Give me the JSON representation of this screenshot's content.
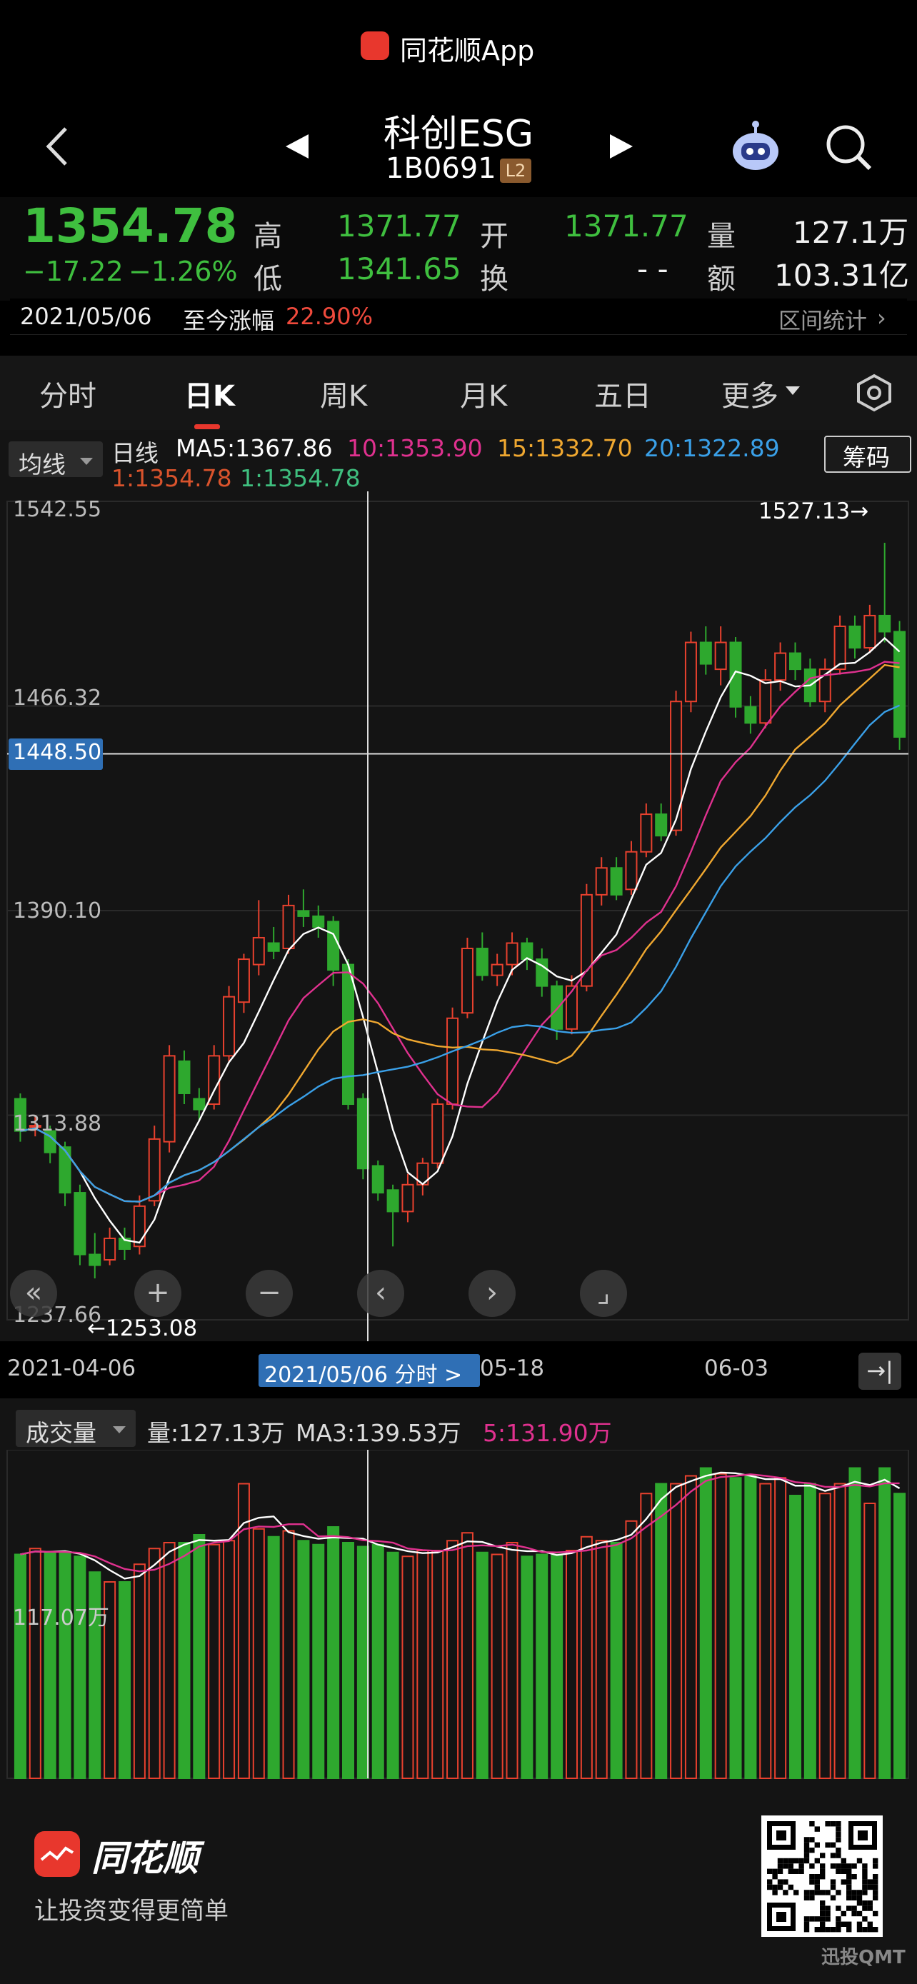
{
  "app": {
    "name": "同花顺App"
  },
  "header": {
    "title": "科创ESG",
    "code": "1B0691",
    "level_badge": "L2"
  },
  "quote": {
    "price": "1354.78",
    "change": "−17.22",
    "change_pct": "−1.26%",
    "high_label": "高",
    "high": "1371.77",
    "low_label": "低",
    "low": "1341.65",
    "open_label": "开",
    "open": "1371.77",
    "turnover_label": "换",
    "turnover": "- -",
    "volume_label": "量",
    "volume": "127.1万",
    "amount_label": "额",
    "amount": "103.31亿"
  },
  "period": {
    "date": "2021/05/06",
    "gain_label": "至今涨幅",
    "gain": "22.90%",
    "stats_label": "区间统计"
  },
  "tabs": [
    "分时",
    "日K",
    "周K",
    "月K",
    "五日",
    "更多"
  ],
  "active_tab": "日K",
  "legend": {
    "dropdown": "均线",
    "period": "日线",
    "ma5": "MA5:1367.86",
    "ma10": "10:1353.90",
    "ma15": "15:1332.70",
    "ma20": "20:1322.89",
    "ma1a": "1:1354.78",
    "ma1b": "1:1354.78",
    "chip_button": "筹码"
  },
  "price_axis": {
    "labels": [
      "1542.55",
      "1466.32",
      "1390.10",
      "1313.88",
      "1237.66"
    ],
    "crosshair_value": "1448.50"
  },
  "annotations": {
    "high_marker": "1527.13→",
    "low_marker": "←1253.08"
  },
  "date_axis": {
    "labels": [
      "2021-04-06",
      "05-18",
      "06-03"
    ],
    "crosshair_date": "2021/05/06 分时 >"
  },
  "volume": {
    "dropdown": "成交量",
    "vol": "量:127.13万",
    "ma3": "MA3:139.53万",
    "ma5": "5:131.90万",
    "axis_label": "117.07万"
  },
  "colors": {
    "up": "#e8412e",
    "down": "#2ea82e",
    "ma5": "#ffffff",
    "ma10": "#e0318f",
    "ma15": "#f0a830",
    "ma20": "#3aa0e8",
    "crosshair_box": "#2f6fb5"
  },
  "chart_data": {
    "type": "candlestick",
    "ylim": [
      1237.66,
      1542.55
    ],
    "candles": [
      [
        1320,
        1308,
        1322,
        1304
      ],
      [
        1310,
        1310,
        1314,
        1306
      ],
      [
        1308,
        1300,
        1310,
        1296
      ],
      [
        1302,
        1285,
        1304,
        1280
      ],
      [
        1285,
        1262,
        1288,
        1258
      ],
      [
        1262,
        1258,
        1270,
        1253.08
      ],
      [
        1260,
        1268,
        1272,
        1258
      ],
      [
        1268,
        1264,
        1272,
        1260
      ],
      [
        1265,
        1280,
        1284,
        1262
      ],
      [
        1282,
        1305,
        1310,
        1280
      ],
      [
        1304,
        1336,
        1340,
        1300
      ],
      [
        1334,
        1322,
        1338,
        1318
      ],
      [
        1320,
        1316,
        1324,
        1312
      ],
      [
        1318,
        1336,
        1340,
        1316
      ],
      [
        1336,
        1358,
        1362,
        1334
      ],
      [
        1356,
        1372,
        1374,
        1352
      ],
      [
        1370,
        1380,
        1394,
        1366
      ],
      [
        1378,
        1375,
        1384,
        1372
      ],
      [
        1376,
        1392,
        1396,
        1374
      ],
      [
        1390,
        1388,
        1398,
        1384
      ],
      [
        1388,
        1384,
        1392,
        1380
      ],
      [
        1386,
        1368,
        1388,
        1362
      ],
      [
        1370,
        1318,
        1372,
        1316
      ],
      [
        1320,
        1294,
        1322,
        1290
      ],
      [
        1295,
        1285,
        1297,
        1282
      ],
      [
        1286,
        1278,
        1288,
        1265
      ],
      [
        1278,
        1288,
        1292,
        1274
      ],
      [
        1288,
        1296,
        1298,
        1284
      ],
      [
        1296,
        1318,
        1320,
        1294
      ],
      [
        1318,
        1350,
        1354,
        1316
      ],
      [
        1352,
        1376,
        1380,
        1350
      ],
      [
        1376,
        1366,
        1382,
        1364
      ],
      [
        1366,
        1370,
        1374,
        1362
      ],
      [
        1370,
        1378,
        1382,
        1366
      ],
      [
        1378,
        1372,
        1380,
        1368
      ],
      [
        1372,
        1362,
        1376,
        1358
      ],
      [
        1362,
        1346,
        1364,
        1342
      ],
      [
        1346,
        1362,
        1366,
        1344
      ],
      [
        1362,
        1396,
        1400,
        1360
      ],
      [
        1396,
        1406,
        1410,
        1392
      ],
      [
        1406,
        1396,
        1410,
        1394
      ],
      [
        1398,
        1412,
        1416,
        1396
      ],
      [
        1412,
        1426,
        1430,
        1410
      ],
      [
        1426,
        1418,
        1430,
        1416
      ],
      [
        1420,
        1468,
        1472,
        1418
      ],
      [
        1468,
        1490,
        1494,
        1464
      ],
      [
        1490,
        1482,
        1496,
        1478
      ],
      [
        1480,
        1490,
        1496,
        1474
      ],
      [
        1490,
        1466,
        1492,
        1462
      ],
      [
        1466,
        1460,
        1470,
        1456
      ],
      [
        1460,
        1476,
        1480,
        1458
      ],
      [
        1476,
        1486,
        1490,
        1472
      ],
      [
        1486,
        1480,
        1490,
        1476
      ],
      [
        1480,
        1468,
        1484,
        1466
      ],
      [
        1468,
        1480,
        1484,
        1464
      ],
      [
        1480,
        1496,
        1500,
        1478
      ],
      [
        1496,
        1488,
        1500,
        1484
      ],
      [
        1488,
        1500,
        1504,
        1486
      ],
      [
        1500,
        1494,
        1527.13,
        1490
      ],
      [
        1494,
        1454.78,
        1498,
        1450
      ]
    ],
    "volume": [
      114,
      117,
      115,
      115,
      113,
      105,
      100,
      100,
      109,
      117,
      120,
      120,
      124,
      119,
      121,
      150,
      127,
      123,
      126,
      121,
      119,
      128,
      120,
      118,
      119,
      115,
      113,
      116,
      116,
      121,
      125,
      115,
      114,
      120,
      113,
      114,
      114,
      116,
      123,
      121,
      120,
      131,
      145,
      150,
      150,
      154,
      158,
      155,
      153,
      154,
      150,
      153,
      144,
      150,
      145,
      150,
      158,
      140,
      158,
      145
    ]
  }
}
